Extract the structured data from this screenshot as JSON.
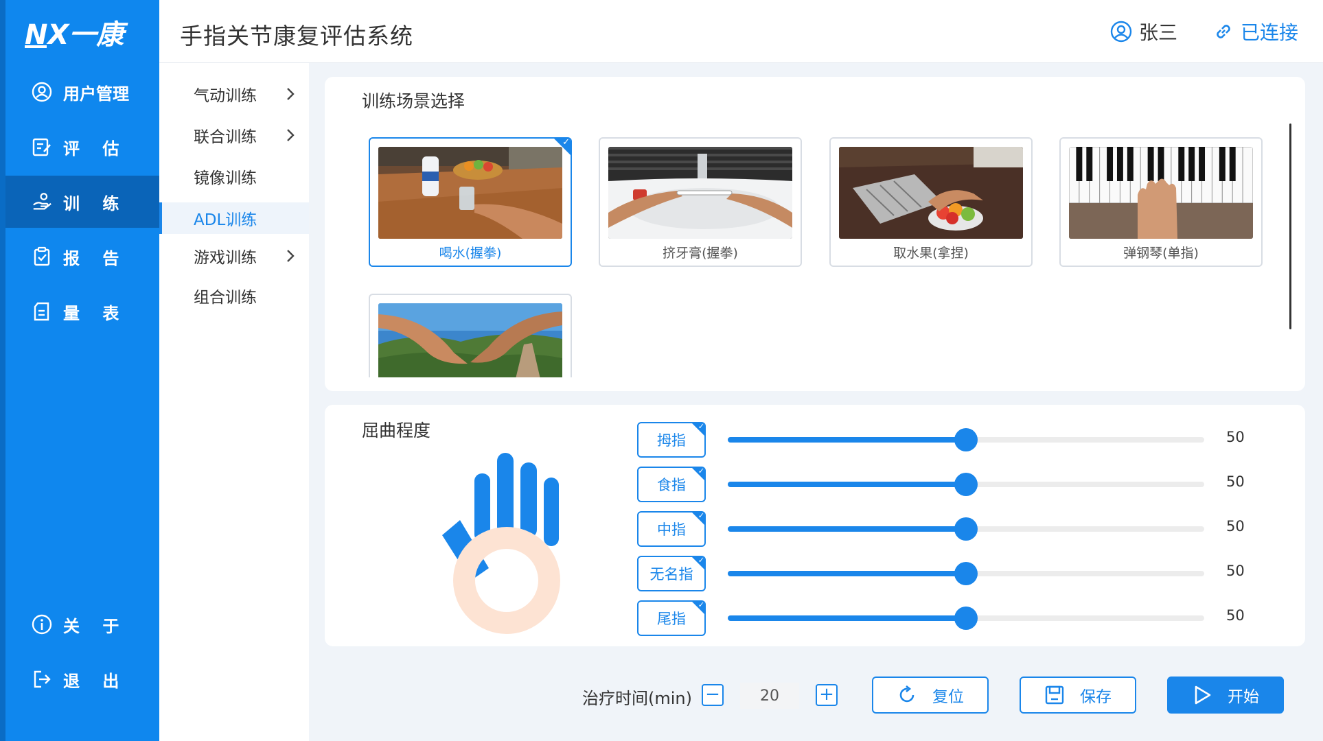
{
  "app": {
    "logo_text": "NX一康",
    "title": "手指关节康复评估系统",
    "user_name": "张三",
    "connection_status": "已连接"
  },
  "sidebar": {
    "items": [
      {
        "label": "用户管理",
        "icon": "user-icon"
      },
      {
        "label": "评    估",
        "icon": "evaluate-icon"
      },
      {
        "label": "训    练",
        "icon": "hand-training-icon",
        "active": true
      },
      {
        "label": "报    告",
        "icon": "report-icon"
      },
      {
        "label": "量    表",
        "icon": "scale-icon"
      }
    ],
    "bottom_items": [
      {
        "label": "关    于",
        "icon": "info-icon"
      },
      {
        "label": "退    出",
        "icon": "logout-icon"
      }
    ]
  },
  "submenu": {
    "items": [
      {
        "label": "气动训练",
        "has_children": true
      },
      {
        "label": "联合训练",
        "has_children": true
      },
      {
        "label": "镜像训练",
        "has_children": false
      },
      {
        "label": "ADL训练",
        "has_children": false,
        "active": true
      },
      {
        "label": "游戏训练",
        "has_children": true
      },
      {
        "label": "组合训练",
        "has_children": false
      }
    ]
  },
  "scene_panel": {
    "title": "训练场景选择",
    "scenes": [
      {
        "caption": "喝水(握拳)",
        "selected": true
      },
      {
        "caption": "挤牙膏(握拳)",
        "selected": false
      },
      {
        "caption": "取水果(拿捏)",
        "selected": false
      },
      {
        "caption": "弹钢琴(单指)",
        "selected": false
      },
      {
        "caption": "",
        "selected": false
      }
    ]
  },
  "bend_panel": {
    "title": "屈曲程度",
    "max": 100,
    "fingers": [
      {
        "label": "拇指",
        "value": 50,
        "checked": true
      },
      {
        "label": "食指",
        "value": 50,
        "checked": true
      },
      {
        "label": "中指",
        "value": 50,
        "checked": true
      },
      {
        "label": "无名指",
        "value": 50,
        "checked": true
      },
      {
        "label": "尾指",
        "value": 50,
        "checked": true
      }
    ]
  },
  "controls": {
    "time_label": "治疗时间(min)",
    "time_value": "20",
    "minus": "−",
    "plus": "+",
    "reset_label": "复位",
    "save_label": "保存",
    "start_label": "开始"
  },
  "colors": {
    "primary": "#1a86ea",
    "sidebar": "#0f87ee",
    "sidebar_active": "#0a64b8",
    "hand_palm": "#fde3d3"
  }
}
